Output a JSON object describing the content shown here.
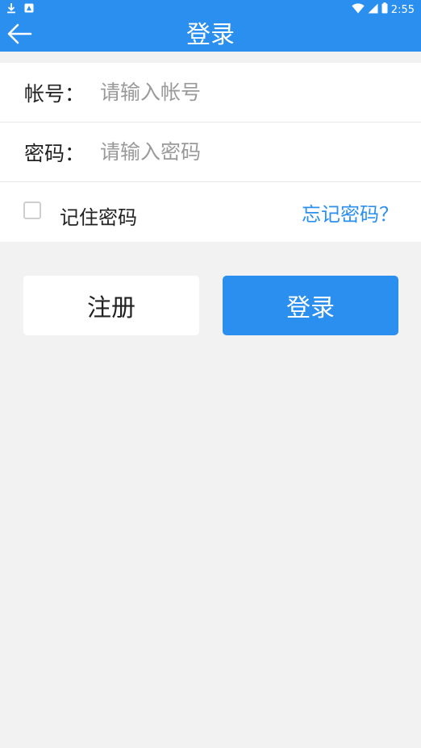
{
  "status_bar": {
    "time": "2:55",
    "left_icons": [
      "download-icon",
      "notification-icon"
    ],
    "right_icons": [
      "wifi-icon",
      "signal-icon",
      "battery-icon"
    ]
  },
  "app_bar": {
    "title": "登录",
    "back_icon": "arrow-left-icon"
  },
  "form": {
    "account_label": "帐号：",
    "account_placeholder": "请输入帐号",
    "account_value": "",
    "password_label": "密码：",
    "password_placeholder": "请输入密码",
    "password_value": "",
    "remember_label": "记住密码",
    "remember_checked": false,
    "forgot_link": "忘记密码？"
  },
  "actions": {
    "register_label": "注册",
    "login_label": "登录"
  },
  "colors": {
    "primary": "#2b8ff0",
    "background": "#f2f2f2",
    "surface": "#ffffff"
  }
}
